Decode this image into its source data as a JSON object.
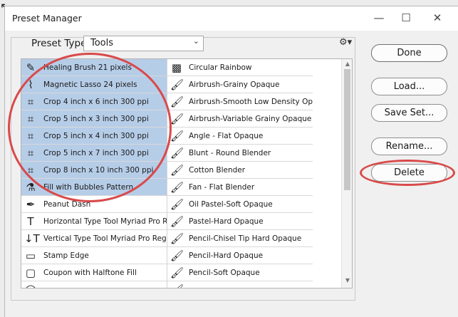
{
  "window": {
    "title": "Preset Manager",
    "minimize_glyph": "—",
    "maximize_glyph": "☐",
    "close_glyph": "✕"
  },
  "preset_type": {
    "label": "Preset Type:",
    "value": "Tools"
  },
  "tools_left": [
    {
      "label": "Healing Brush 21 pixels",
      "icon": "healing-brush-icon",
      "glyph": "✎",
      "selected": true
    },
    {
      "label": "Magnetic Lasso 24 pixels",
      "icon": "magnetic-lasso-icon",
      "glyph": "⌇",
      "selected": true
    },
    {
      "label": "Crop 4 inch x 6 inch 300 ppi",
      "icon": "crop-icon",
      "glyph": "⌗",
      "selected": true
    },
    {
      "label": "Crop 5 inch x 3 inch 300 ppi",
      "icon": "crop-icon",
      "glyph": "⌗",
      "selected": true
    },
    {
      "label": "Crop 5 inch x 4 inch 300 ppi",
      "icon": "crop-icon",
      "glyph": "⌗",
      "selected": true
    },
    {
      "label": "Crop 5 inch x 7 inch 300 ppi",
      "icon": "crop-icon",
      "glyph": "⌗",
      "selected": true
    },
    {
      "label": "Crop 8 inch x 10 inch 300 ppi",
      "icon": "crop-icon",
      "glyph": "⌗",
      "selected": true
    },
    {
      "label": "Fill with Bubbles Pattern",
      "icon": "paint-bucket-icon",
      "glyph": "⚗",
      "selected": true
    },
    {
      "label": "Peanut Dash",
      "icon": "pen-icon",
      "glyph": "✒",
      "selected": false
    },
    {
      "label": "Horizontal Type Tool Myriad Pro Re...",
      "icon": "horizontal-type-icon",
      "glyph": "T",
      "selected": false
    },
    {
      "label": "Vertical Type Tool Myriad Pro Regul...",
      "icon": "vertical-type-icon",
      "glyph": "↓T",
      "selected": false
    },
    {
      "label": "Stamp Edge",
      "icon": "rectangle-icon",
      "glyph": "▭",
      "selected": false
    },
    {
      "label": "Coupon with Halftone Fill",
      "icon": "rounded-rectangle-icon",
      "glyph": "▢",
      "selected": false
    },
    {
      "label": "",
      "icon": "ellipse-icon",
      "glyph": "◯",
      "selected": false
    }
  ],
  "tools_right": [
    {
      "label": "Circular Rainbow",
      "icon": "gradient-icon",
      "glyph": "▩"
    },
    {
      "label": "Airbrush-Grainy Opaque",
      "icon": "brush-icon",
      "glyph": "🖌"
    },
    {
      "label": "Airbrush-Smooth Low Density Opaq...",
      "icon": "brush-icon",
      "glyph": "🖌"
    },
    {
      "label": "Airbrush-Variable Grainy Opaque",
      "icon": "brush-icon",
      "glyph": "🖌"
    },
    {
      "label": "Angle - Flat Opaque",
      "icon": "brush-icon",
      "glyph": "🖌"
    },
    {
      "label": "Blunt - Round Blender",
      "icon": "brush-icon",
      "glyph": "🖌"
    },
    {
      "label": "Cotton Blender",
      "icon": "brush-icon",
      "glyph": "🖌"
    },
    {
      "label": "Fan - Flat Blender",
      "icon": "brush-icon",
      "glyph": "🖌"
    },
    {
      "label": "Oil Pastel-Soft Opaque",
      "icon": "brush-icon",
      "glyph": "🖌"
    },
    {
      "label": "Pastel-Hard Opaque",
      "icon": "brush-icon",
      "glyph": "🖌"
    },
    {
      "label": "Pencil-Chisel Tip Hard Opaque",
      "icon": "brush-icon",
      "glyph": "🖌"
    },
    {
      "label": "Pencil-Hard Opaque",
      "icon": "brush-icon",
      "glyph": "🖌"
    },
    {
      "label": "Pencil-Soft Opaque",
      "icon": "brush-icon",
      "glyph": "🖌"
    },
    {
      "label": "",
      "icon": "brush-icon",
      "glyph": "🖌"
    }
  ],
  "buttons": {
    "done": "Done",
    "load": "Load...",
    "save_set": "Save Set...",
    "rename": "Rename...",
    "delete": "Delete"
  },
  "colors": {
    "selection": "#b6cde8",
    "highlight_ring": "#d94a4a"
  }
}
